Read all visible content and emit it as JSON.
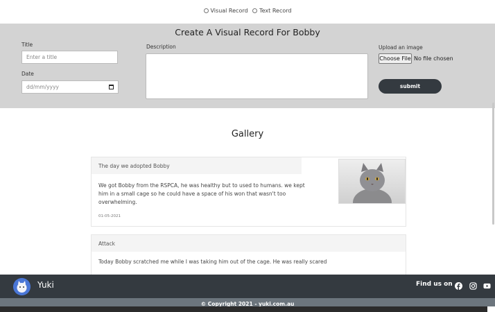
{
  "record_type": {
    "options": [
      "Visual Record",
      "Text Record"
    ]
  },
  "form": {
    "heading": "Create A Visual Record For Bobby",
    "title_label": "Title",
    "title_placeholder": "Enter a title",
    "date_label": "Date",
    "date_placeholder": "dd/mm/yyyy",
    "description_label": "Description",
    "upload_label": "Upload an image",
    "choose_file_label": "Choose File",
    "file_status": "No file chosen",
    "submit_label": "submit"
  },
  "gallery": {
    "heading": "Gallery",
    "records": [
      {
        "title": "The day we adopted Bobby",
        "body_lines": [
          "We got Bobby from the RSPCA, he was healthy but to used to humans. we kept",
          "him in a small cage so he could have a space of his won that wasn't too",
          "overwhelming."
        ],
        "date": "01-05-2021"
      },
      {
        "title": "Attack",
        "body_lines": [
          "Today Bobby scratched me while I was taking him out of the cage. He was really scared"
        ]
      }
    ]
  },
  "footer": {
    "brand": "Yuki",
    "find_us": "Find us on",
    "social_icons": [
      "facebook-icon",
      "instagram-icon",
      "youtube-icon"
    ],
    "copyright": "© Copyright 2021 - yuki.com.au"
  },
  "colors": {
    "panel": "#d3d3d3",
    "dark": "#343a40",
    "copyright_bar": "#6c757d"
  }
}
